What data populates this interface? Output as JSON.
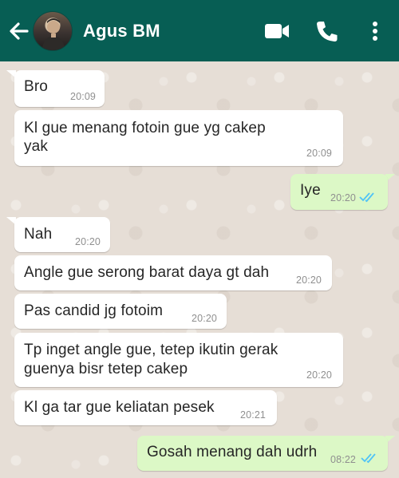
{
  "header": {
    "contact_name": "Agus BM",
    "icons": [
      "back-arrow-icon",
      "avatar",
      "video-call-icon",
      "phone-call-icon",
      "more-options-icon"
    ],
    "bg_color": "#075e54"
  },
  "messages": [
    {
      "direction": "in",
      "text": "Bro",
      "time": "20:09"
    },
    {
      "direction": "in",
      "text_line1": "Kl gue menang fotoin gue yg cakep",
      "text_line2": "yak",
      "time": "20:09"
    },
    {
      "direction": "out",
      "text": "Iye",
      "time": "20:20",
      "status": "read"
    },
    {
      "direction": "in",
      "text": "Nah",
      "time": "20:20"
    },
    {
      "direction": "in",
      "text": "Angle gue serong barat daya gt dah",
      "time": "20:20"
    },
    {
      "direction": "in",
      "text": "Pas candid jg fotoim",
      "time": "20:20"
    },
    {
      "direction": "in",
      "text_line1": "Tp inget angle gue, tetep ikutin gerak",
      "text_line2": "guenya bisr tetep cakep",
      "time": "20:20"
    },
    {
      "direction": "in",
      "text": "Kl ga tar gue keliatan pesek",
      "time": "20:21"
    },
    {
      "direction": "out",
      "text": "Gosah menang dah udrh",
      "time": "08:22",
      "status": "read"
    }
  ],
  "colors": {
    "incoming_bubble": "#ffffff",
    "outgoing_bubble": "#dcf8c6",
    "read_ticks": "#4fc3f7",
    "wallpaper": "#e5ddd5"
  }
}
